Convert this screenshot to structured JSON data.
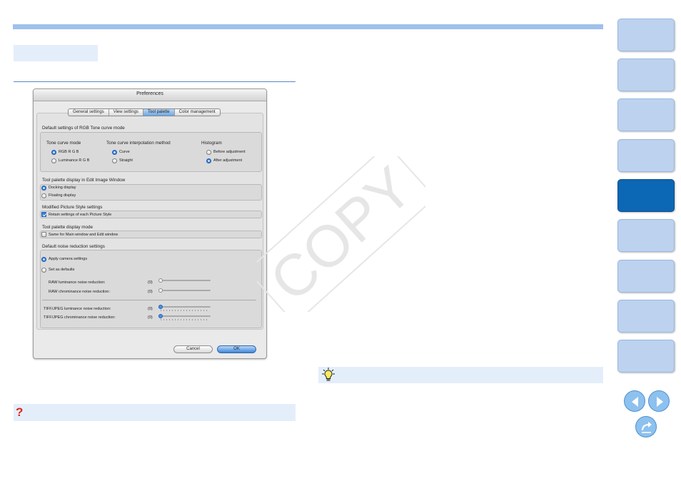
{
  "dialog": {
    "title": "Preferences",
    "tabs": [
      {
        "label": "General settings",
        "active": false
      },
      {
        "label": "View settings",
        "active": false
      },
      {
        "label": "Tool palette",
        "active": true
      },
      {
        "label": "Color management",
        "active": false
      }
    ],
    "rgb_tone_curve": {
      "heading": "Default settings of RGB Tone curve mode",
      "tone_curve_mode": {
        "heading": "Tone curve mode",
        "options": [
          {
            "label": "RGB R G B",
            "selected": true
          },
          {
            "label": "Luminance R G B",
            "selected": false
          }
        ]
      },
      "interpolation": {
        "heading": "Tone curve interpolation method",
        "options": [
          {
            "label": "Curve",
            "selected": true
          },
          {
            "label": "Straight",
            "selected": false
          }
        ]
      },
      "histogram": {
        "heading": "Histogram",
        "options": [
          {
            "label": "Before adjustment",
            "selected": false
          },
          {
            "label": "After adjustment",
            "selected": true
          }
        ]
      }
    },
    "palette_display": {
      "heading": "Tool palette display in Edit Image Window",
      "options": [
        {
          "label": "Docking display",
          "selected": true
        },
        {
          "label": "Floating display",
          "selected": false
        }
      ]
    },
    "picture_style": {
      "heading": "Modified Picture Style settings",
      "checkbox": {
        "label": "Retain settings of each Picture Style",
        "checked": true
      }
    },
    "display_mode": {
      "heading": "Tool palette display mode",
      "checkbox": {
        "label": "Same for Main window and Edit window",
        "checked": false
      }
    },
    "noise": {
      "heading": "Default noise reduction settings",
      "options": [
        {
          "label": "Apply camera settings",
          "selected": true
        },
        {
          "label": "Set as defaults",
          "selected": false
        }
      ],
      "sliders": [
        {
          "label": "RAW luminance noise reduction:",
          "value": "(0)",
          "enabled": false
        },
        {
          "label": "RAW chrominance noise reduction:",
          "value": "(0)",
          "enabled": false
        },
        {
          "label": "TIFF/JPEG luminance noise reduction:",
          "value": "(0)",
          "enabled": true
        },
        {
          "label": "TIFF/JPEG chrominance noise reduction:",
          "value": "(0)",
          "enabled": true
        }
      ]
    },
    "buttons": {
      "cancel": "Cancel",
      "ok": "OK"
    }
  },
  "watermark": {
    "text": "COPY",
    "color": "#e6e6e6"
  },
  "icons": {
    "tip": "lightbulb-icon",
    "help": "question-mark-icon",
    "prev": "arrow-left-icon",
    "next": "arrow-right-icon",
    "back": "return-arrow-icon"
  },
  "help_mark": "?",
  "colors": {
    "accent": "#9fc1ec",
    "panel": "#e4eefb",
    "nav_active": "#0c67b4",
    "nav": "#bcd2ee",
    "help_mark": "#e0261a"
  }
}
